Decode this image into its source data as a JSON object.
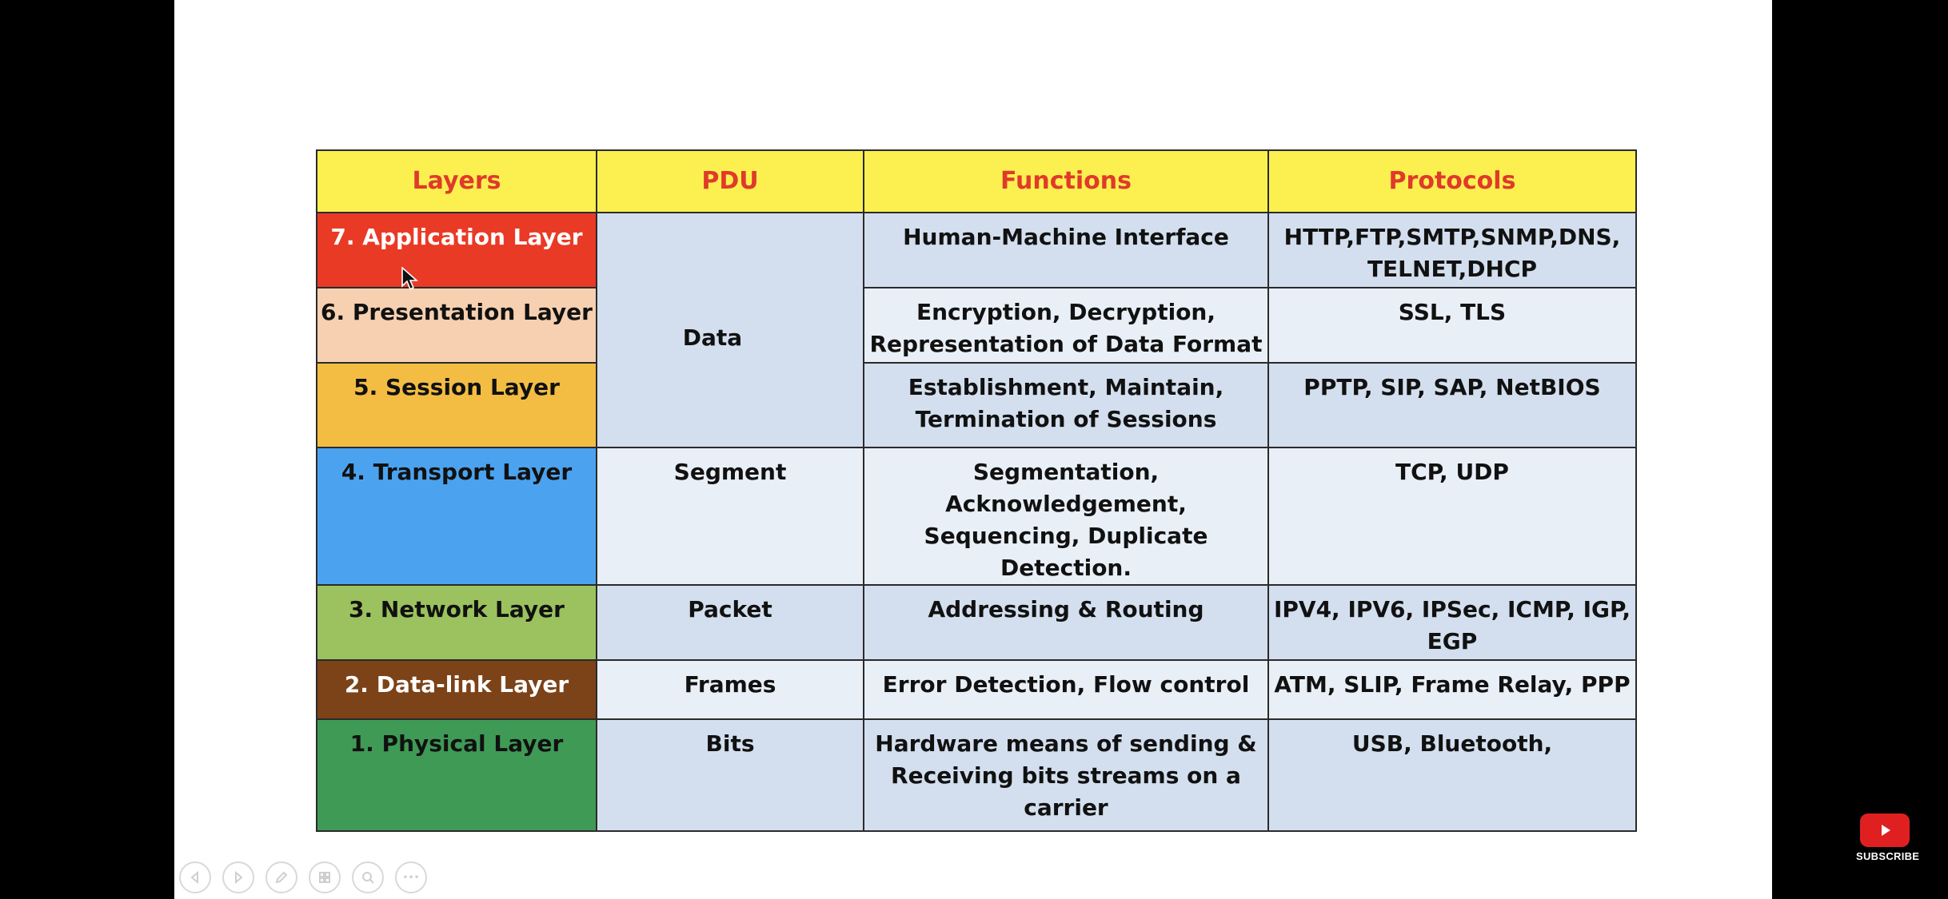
{
  "table": {
    "headers": {
      "layers": "Layers",
      "pdu": "PDU",
      "functions": "Functions",
      "protocols": "Protocols"
    },
    "rows": [
      {
        "layer": "7. Application Layer",
        "layer_color": "#e93a26",
        "function_lines": [
          "Human-Machine Interface"
        ],
        "protocol_lines": [
          "HTTP,FTP,SMTP,SNMP,DNS,",
          "TELNET,DHCP"
        ]
      },
      {
        "layer": "6. Presentation Layer",
        "layer_color": "#f6d0b0",
        "function_lines": [
          "Encryption, Decryption,",
          "Representation of Data Format"
        ],
        "protocol_lines": [
          "SSL, TLS"
        ]
      },
      {
        "layer": "5. Session Layer",
        "layer_color": "#f3bd44",
        "function_lines": [
          "Establishment, Maintain,",
          "Termination of Sessions"
        ],
        "protocol_lines": [
          "PPTP, SIP, SAP, NetBIOS"
        ]
      },
      {
        "layer": "4. Transport Layer",
        "layer_color": "#4ba3ef",
        "pdu": "Segment",
        "function_lines": [
          "Segmentation, Acknowledgement,",
          "Sequencing, Duplicate Detection."
        ],
        "protocol_lines": [
          "TCP, UDP"
        ]
      },
      {
        "layer": "3. Network Layer",
        "layer_color": "#9bc25e",
        "pdu": "Packet",
        "function_lines": [
          "Addressing & Routing"
        ],
        "protocol_lines": [
          "IPV4, IPV6, IPSec, ICMP, IGP,",
          "EGP"
        ]
      },
      {
        "layer": "2. Data-link Layer",
        "layer_color": "#7c4218",
        "pdu": "Frames",
        "function_lines": [
          "Error Detection, Flow control"
        ],
        "protocol_lines": [
          "ATM, SLIP, Frame Relay, PPP"
        ]
      },
      {
        "layer": "1. Physical Layer",
        "layer_color": "#3f9a56",
        "pdu": "Bits",
        "function_lines": [
          "Hardware means of sending &",
          "Receiving bits streams on a carrier"
        ],
        "protocol_lines": [
          "USB, Bluetooth,"
        ]
      }
    ],
    "shared_pdu": "Data"
  },
  "colors": {
    "header_bg": "#fbf050",
    "header_text": "#e03a2a",
    "cell_dark": "#d3dfee",
    "cell_light": "#e9eff7"
  },
  "controls": {
    "icons": [
      "prev-icon",
      "next-icon",
      "pen-icon",
      "slides-icon",
      "zoom-icon",
      "more-icon"
    ],
    "more_label": "•••"
  },
  "youtube": {
    "subscribe_label": "SUBSCRIBE"
  }
}
